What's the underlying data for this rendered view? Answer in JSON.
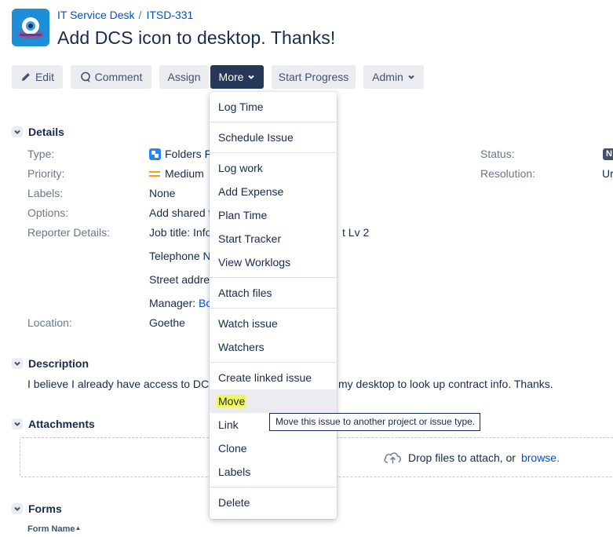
{
  "header": {
    "project_name": "IT Service Desk",
    "breadcrumb_separator": "/",
    "issue_key": "ITSD-331",
    "title": "Add DCS icon to desktop. Thanks!"
  },
  "toolbar": {
    "edit": "Edit",
    "comment": "Comment",
    "assign": "Assign",
    "more": "More",
    "start_progress": "Start Progress",
    "admin": "Admin"
  },
  "details": {
    "heading": "Details",
    "type_label": "Type:",
    "type_value": "Folders Fi",
    "priority_label": "Priority:",
    "priority_value": "Medium",
    "labels_label": "Labels:",
    "labels_value": "None",
    "options_label": "Options:",
    "options_value": "Add shared f",
    "reporter_label": "Reporter Details:",
    "job_title": "Job title:  Info",
    "job_title_tail": "t Lv 2",
    "telephone": "Telephone N",
    "street": "Street addres",
    "manager_label": "Manager:",
    "manager_value": "Bo",
    "location_label": "Location:",
    "location_value": "Goethe",
    "status_label": "Status:",
    "status_value": "N",
    "resolution_label": "Resolution:",
    "resolution_value": "Ur"
  },
  "description": {
    "heading": "Description",
    "text_left": "I believe I already have access to DCS,",
    "text_right": "my desktop to look up contract info. Thanks."
  },
  "attachments": {
    "heading": "Attachments",
    "drop_text": "Drop files to attach, or",
    "browse": "browse."
  },
  "forms": {
    "heading": "Forms",
    "column": "Form Name"
  },
  "more_menu": {
    "items": [
      "Log Time",
      "Schedule Issue",
      "Log work",
      "Add Expense",
      "Plan Time",
      "Start Tracker",
      "View Worklogs",
      "Attach files",
      "Watch issue",
      "Watchers",
      "Create linked issue",
      "Move",
      "Link",
      "Clone",
      "Labels",
      "Delete"
    ],
    "hovered": "Move"
  },
  "tooltip": "Move this issue to another project or issue type.",
  "colors": {
    "brand_link": "#0052cc",
    "text": "#172b4d",
    "button_bg": "#ebecf0",
    "active_button_bg": "#253858",
    "priority_medium": "#ff991f",
    "highlight": "#f3f75a"
  }
}
